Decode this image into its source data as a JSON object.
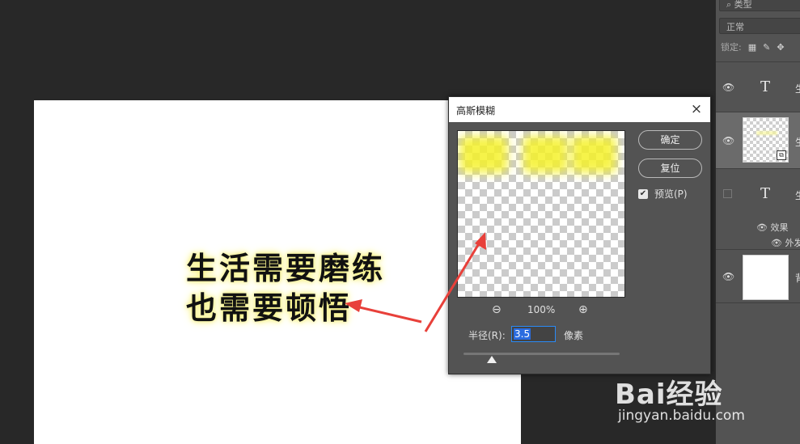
{
  "document": {
    "line1": "生活需要磨练",
    "line2": "也需要顿悟"
  },
  "layers_panel": {
    "kind_filter": "类型",
    "blend_mode": "正常",
    "lock_label": "锁定:",
    "layers": [
      {
        "type": "text",
        "icon": "T",
        "name": "生"
      },
      {
        "type": "smart-object",
        "name": "生"
      },
      {
        "type": "text",
        "icon": "T",
        "name": "生",
        "effects_label": "效果",
        "effect_item": "外发"
      },
      {
        "type": "background",
        "name": "背"
      }
    ]
  },
  "dialog": {
    "title": "高斯模糊",
    "close_glyph": "×",
    "ok_label": "确定",
    "reset_label": "复位",
    "preview_label": "预览(P)",
    "preview_checked": true,
    "zoom_percent": "100%",
    "radius_label": "半径(R):",
    "radius_value": "3.5",
    "radius_unit": "像素",
    "radius_slider_fraction": 0.18
  },
  "watermark": {
    "brand": "Bai经验",
    "url": "jingyan.baidu.com"
  },
  "colors": {
    "annotation_arrow": "#e8403a",
    "glow": "#f7f28a",
    "accent": "#2a8af6"
  }
}
